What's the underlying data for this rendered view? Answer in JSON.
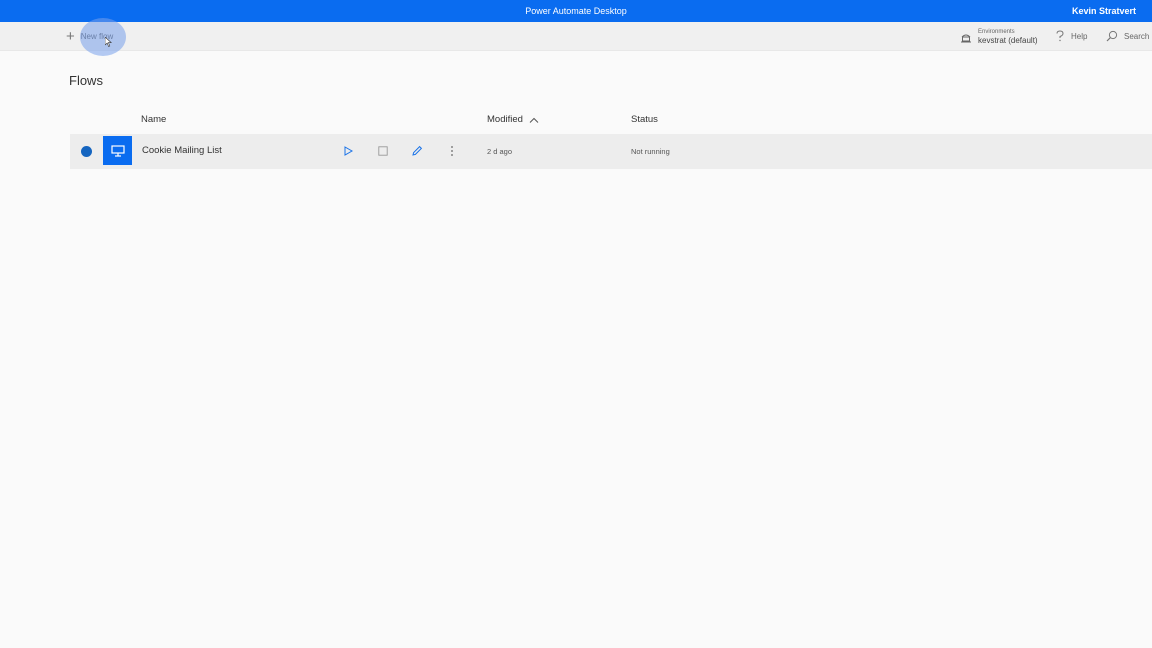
{
  "titlebar": {
    "app_title": "Power Automate Desktop",
    "user_name": "Kevin Stratvert",
    "color": "#0a6cf0"
  },
  "commandbar": {
    "new_flow_label": "New flow",
    "environment_label": "Environments",
    "environment_value": "kevstrat (default)",
    "help_label": "Help",
    "search_label": "Search"
  },
  "main": {
    "title": "Flows",
    "columns": {
      "name": "Name",
      "modified": "Modified",
      "status": "Status"
    },
    "rows": [
      {
        "name": "Cookie Mailing List",
        "modified": "2 d ago",
        "status": "Not running",
        "selected": true
      }
    ]
  },
  "icons": {
    "new_flow": "plus-icon",
    "environment": "environment-icon",
    "help": "help-icon",
    "search": "search-icon",
    "sort": "chevron-up-icon",
    "flow_tile": "desktop-flow-icon",
    "run": "play-icon",
    "stop": "stop-icon",
    "edit": "edit-icon",
    "more": "more-icon"
  },
  "colors": {
    "accent": "#0a6cf0",
    "selected_dot": "#1565c0"
  }
}
